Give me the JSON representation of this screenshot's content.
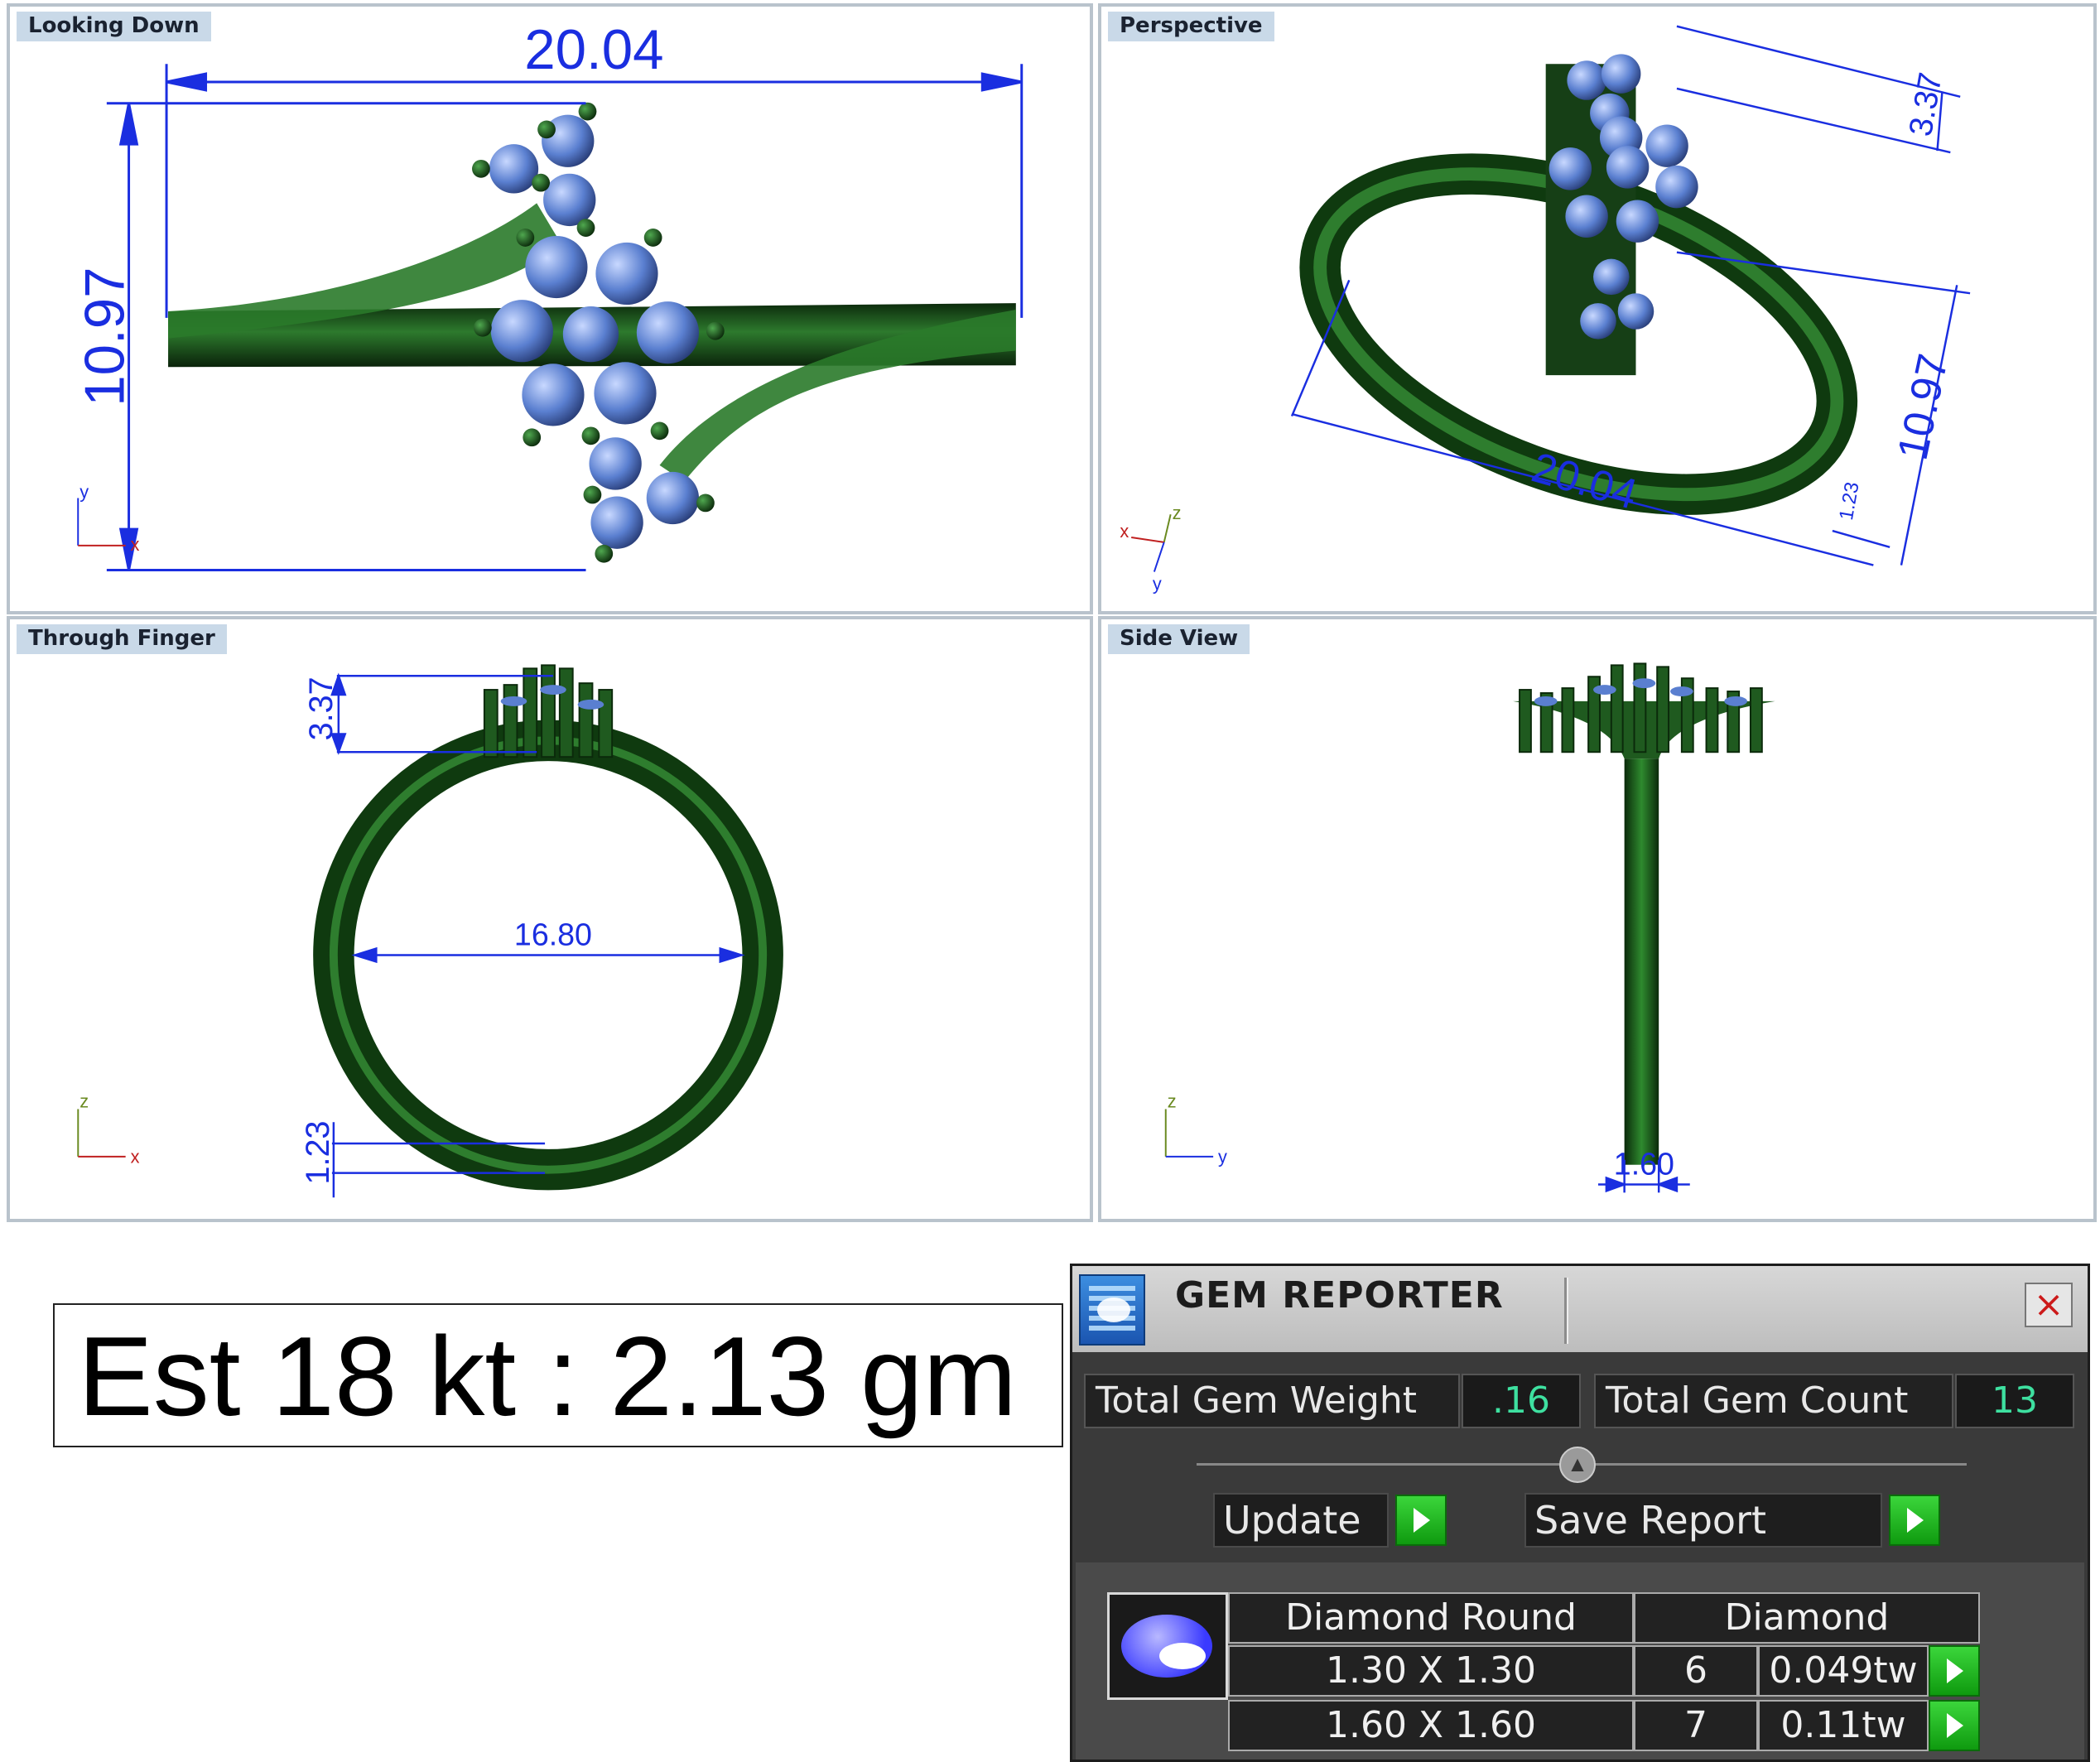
{
  "viewports": {
    "top": {
      "label": "Looking Down",
      "axes": {
        "a": "y",
        "b": "x"
      },
      "dims": {
        "width": "20.04",
        "height": "10.97"
      }
    },
    "persp": {
      "label": "Perspective",
      "axes": {
        "a": "z",
        "b": "x",
        "c": "y"
      },
      "dims": {
        "length": "20.04",
        "height": "10.97",
        "depth": "3.37",
        "small": "1.23"
      }
    },
    "front": {
      "label": "Through Finger",
      "axes": {
        "a": "z",
        "b": "x"
      },
      "dims": {
        "inner": "16.80",
        "top": "3.37",
        "bottom": "1.23"
      }
    },
    "side": {
      "label": "Side View",
      "axes": {
        "a": "z",
        "b": "y"
      },
      "dims": {
        "shank": "1.60"
      }
    }
  },
  "weight": "Est 18 kt : 2.13 gm",
  "gem_reporter": {
    "title": "GEM REPORTER",
    "close": "×",
    "total_weight_label": "Total Gem Weight",
    "total_weight_value": ".16",
    "total_count_label": "Total Gem Count",
    "total_count_value": "13",
    "update_label": "Update",
    "save_label": "Save Report",
    "table": {
      "header_shape": "Diamond Round",
      "header_type": "Diamond",
      "rows": [
        {
          "size": "1.30 X 1.30",
          "count": "6",
          "weight": "0.049tw"
        },
        {
          "size": "1.60 X 1.60",
          "count": "7",
          "weight": "0.11tw"
        }
      ]
    }
  },
  "colors": {
    "metal": "#1f5a1f",
    "gem": "#5a7fd0",
    "dimension": "#1a2ee0"
  }
}
